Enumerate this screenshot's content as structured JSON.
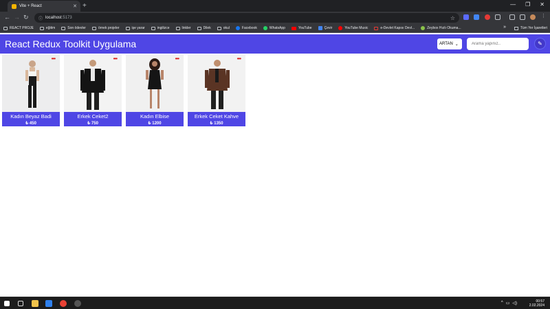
{
  "browser": {
    "tab_title": "Vite + React",
    "url_host": "localhost",
    "url_port": ":5173",
    "bookmarks": [
      "REACT PROJE",
      "eğitim",
      "Son ödevler",
      "örnek projeler",
      "işe yarar",
      "ingilizce",
      "linkler",
      "Dilek",
      "okul",
      "Facebook",
      "WhatsApp",
      "YouTube",
      "Çevir",
      "YouTube Music",
      "e-Devlet Kapısı Devl...",
      "Zeybox Hızlı Okuma..."
    ],
    "all_bookmarks_label": "Tüm Yer İşaretleri"
  },
  "app": {
    "title": "React Redux Toolkit Uygulama",
    "sort_value": "ARTAN",
    "search_placeholder": "Arama yapınız.."
  },
  "products": [
    {
      "name": "Kadın Beyaz Badi",
      "price": "₺ 450"
    },
    {
      "name": "Erkek Ceket2",
      "price": "₺ 750"
    },
    {
      "name": "Kadın Elbise",
      "price": "₺ 1200"
    },
    {
      "name": "Erkek Ceket Kahve",
      "price": "₺ 1350"
    }
  ],
  "taskbar": {
    "time": "00:57",
    "date": "2.02.2024"
  },
  "colors": {
    "accent": "#4f46e5",
    "menu_dots": "#dc2626"
  }
}
